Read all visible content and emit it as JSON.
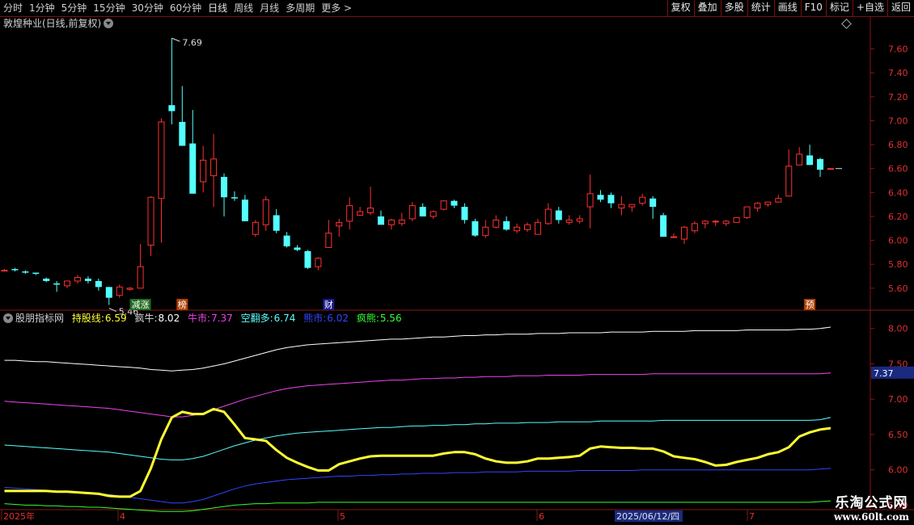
{
  "toolbar": {
    "periods": [
      "分时",
      "1分钟",
      "5分钟",
      "15分钟",
      "30分钟",
      "60分钟",
      "日线",
      "周线",
      "月线",
      "多周期",
      "更多 >"
    ],
    "tools": [
      "复权",
      "叠加",
      "多股",
      "统计",
      "画线",
      "F10",
      "标记",
      "+自选",
      "返回"
    ]
  },
  "stock_title": "敦煌种业(日线,前复权)",
  "indicator": {
    "name": "股朋指标网",
    "items": [
      {
        "label": "持股线:",
        "value": "6.59",
        "color": "#ffff33"
      },
      {
        "label": "疯牛:",
        "value": "8.02",
        "color": "#ffffff"
      },
      {
        "label": "牛市:",
        "value": "7.37",
        "color": "#ee44ee"
      },
      {
        "label": "空翻多:",
        "value": "6.74",
        "color": "#55ffff"
      },
      {
        "label": "熊市:",
        "value": "6.02",
        "color": "#3344ff"
      },
      {
        "label": "疯熊:",
        "value": "5.56",
        "color": "#33ff33"
      }
    ]
  },
  "annotations": {
    "high": "7.69",
    "low": "5.46"
  },
  "markers": [
    {
      "text": "减涨",
      "bg": "#1f6b1f",
      "index": 13
    },
    {
      "text": "榜",
      "bg": "#b04000",
      "index": 17
    },
    {
      "text": "财",
      "bg": "#1a1a8a",
      "index": 31
    },
    {
      "text": "预",
      "bg": "#b04000",
      "index": 77
    }
  ],
  "price_ticks": [
    "7.60",
    "7.40",
    "7.20",
    "7.00",
    "6.80",
    "6.60",
    "6.40",
    "6.20",
    "6.00",
    "5.80",
    "5.60"
  ],
  "ind_ticks": [
    "8.00",
    "7.50",
    "7.00",
    "6.50",
    "6.00",
    "5.50"
  ],
  "ind_tag": "7.37",
  "date_labels": [
    "2025年",
    "4",
    "5",
    "6",
    "2025/06/12/四",
    "7"
  ],
  "watermark": {
    "line1": "乐淘公式网",
    "line2": "www.60lt.com"
  },
  "chart_data": [
    {
      "type": "candlestick",
      "title": "敦煌种业(日线,前复权)",
      "ylim": [
        5.43,
        7.82
      ],
      "colors": {
        "up": "#ff3030",
        "down": "#54ffff"
      },
      "candles": [
        [
          5.75,
          5.76,
          5.75,
          5.75
        ],
        [
          5.76,
          5.77,
          5.74,
          5.75
        ],
        [
          5.74,
          5.75,
          5.72,
          5.73
        ],
        [
          5.73,
          5.73,
          5.71,
          5.72
        ],
        [
          5.68,
          5.69,
          5.65,
          5.66
        ],
        [
          5.64,
          5.66,
          5.57,
          5.63
        ],
        [
          5.62,
          5.66,
          5.6,
          5.66
        ],
        [
          5.66,
          5.71,
          5.64,
          5.69
        ],
        [
          5.68,
          5.7,
          5.64,
          5.66
        ],
        [
          5.66,
          5.68,
          5.58,
          5.61
        ],
        [
          5.61,
          5.61,
          5.46,
          5.52
        ],
        [
          5.54,
          5.63,
          5.52,
          5.61
        ],
        [
          5.59,
          5.61,
          5.58,
          5.6
        ],
        [
          5.6,
          5.97,
          5.6,
          5.78
        ],
        [
          5.96,
          6.37,
          5.87,
          6.36
        ],
        [
          6.35,
          7.02,
          5.98,
          6.99
        ],
        [
          7.13,
          7.69,
          6.97,
          7.08
        ],
        [
          6.99,
          7.29,
          6.83,
          6.79
        ],
        [
          6.81,
          7.09,
          6.73,
          6.39
        ],
        [
          6.49,
          6.79,
          6.4,
          6.67
        ],
        [
          6.54,
          6.89,
          6.28,
          6.68
        ],
        [
          6.53,
          6.56,
          6.2,
          6.36
        ],
        [
          6.36,
          6.41,
          6.33,
          6.35
        ],
        [
          6.34,
          6.38,
          6.16,
          6.16
        ],
        [
          6.05,
          6.17,
          6.03,
          6.15
        ],
        [
          6.13,
          6.37,
          6.08,
          6.34
        ],
        [
          6.21,
          6.26,
          6.06,
          6.08
        ],
        [
          6.04,
          6.07,
          5.94,
          5.95
        ],
        [
          5.94,
          5.96,
          5.91,
          5.92
        ],
        [
          5.91,
          5.92,
          5.76,
          5.77
        ],
        [
          5.78,
          5.86,
          5.75,
          5.85
        ],
        [
          5.94,
          6.17,
          5.94,
          6.06
        ],
        [
          6.12,
          6.18,
          6.03,
          6.15
        ],
        [
          6.16,
          6.36,
          6.09,
          6.29
        ],
        [
          6.21,
          6.28,
          6.21,
          6.24
        ],
        [
          6.23,
          6.45,
          6.21,
          6.27
        ],
        [
          6.2,
          6.25,
          6.14,
          6.13
        ],
        [
          6.13,
          6.18,
          6.09,
          6.17
        ],
        [
          6.14,
          6.23,
          6.12,
          6.17
        ],
        [
          6.18,
          6.32,
          6.16,
          6.29
        ],
        [
          6.28,
          6.31,
          6.21,
          6.2
        ],
        [
          6.2,
          6.25,
          6.18,
          6.24
        ],
        [
          6.26,
          6.33,
          6.25,
          6.33
        ],
        [
          6.33,
          6.34,
          6.27,
          6.29
        ],
        [
          6.28,
          6.31,
          6.14,
          6.17
        ],
        [
          6.16,
          6.18,
          6.03,
          6.04
        ],
        [
          6.04,
          6.17,
          6.02,
          6.11
        ],
        [
          6.11,
          6.21,
          6.1,
          6.17
        ],
        [
          6.16,
          6.2,
          6.08,
          6.09
        ],
        [
          6.08,
          6.14,
          6.06,
          6.11
        ],
        [
          6.09,
          6.15,
          6.07,
          6.13
        ],
        [
          6.05,
          6.18,
          6.05,
          6.15
        ],
        [
          6.14,
          6.31,
          6.13,
          6.26
        ],
        [
          6.25,
          6.28,
          6.14,
          6.17
        ],
        [
          6.15,
          6.21,
          6.13,
          6.17
        ],
        [
          6.16,
          6.21,
          6.14,
          6.18
        ],
        [
          6.28,
          6.55,
          6.1,
          6.39
        ],
        [
          6.38,
          6.42,
          6.32,
          6.34
        ],
        [
          6.38,
          6.4,
          6.27,
          6.31
        ],
        [
          6.27,
          6.37,
          6.21,
          6.3
        ],
        [
          6.28,
          6.3,
          6.24,
          6.3
        ],
        [
          6.31,
          6.39,
          6.29,
          6.36
        ],
        [
          6.35,
          6.37,
          6.18,
          6.28
        ],
        [
          6.21,
          6.23,
          6.03,
          6.03
        ],
        [
          6.03,
          6.06,
          6.02,
          6.03
        ],
        [
          6.01,
          6.12,
          5.97,
          6.11
        ],
        [
          6.08,
          6.16,
          6.06,
          6.14
        ],
        [
          6.14,
          6.17,
          6.1,
          6.16
        ],
        [
          6.16,
          6.17,
          6.12,
          6.16
        ],
        [
          6.14,
          6.17,
          6.12,
          6.16
        ],
        [
          6.15,
          6.19,
          6.15,
          6.19
        ],
        [
          6.19,
          6.28,
          6.18,
          6.28
        ],
        [
          6.27,
          6.32,
          6.24,
          6.31
        ],
        [
          6.3,
          6.32,
          6.28,
          6.32
        ],
        [
          6.32,
          6.38,
          6.32,
          6.35
        ],
        [
          6.37,
          6.76,
          6.37,
          6.62
        ],
        [
          6.63,
          6.78,
          6.63,
          6.72
        ],
        [
          6.71,
          6.8,
          6.63,
          6.63
        ],
        [
          6.68,
          6.69,
          6.53,
          6.59
        ],
        [
          6.6,
          6.6,
          6.6,
          6.6
        ]
      ]
    },
    {
      "type": "line",
      "title": "股朋指标网",
      "ylim": [
        5.47,
        8.1
      ],
      "x_count": 80,
      "series": [
        {
          "name": "疯牛",
          "color": "#ffffff",
          "values": [
            7.55,
            7.55,
            7.54,
            7.53,
            7.53,
            7.52,
            7.51,
            7.5,
            7.49,
            7.48,
            7.47,
            7.46,
            7.45,
            7.44,
            7.42,
            7.41,
            7.4,
            7.41,
            7.42,
            7.44,
            7.47,
            7.5,
            7.54,
            7.58,
            7.62,
            7.66,
            7.7,
            7.73,
            7.75,
            7.77,
            7.78,
            7.79,
            7.8,
            7.81,
            7.82,
            7.83,
            7.84,
            7.85,
            7.85,
            7.86,
            7.87,
            7.88,
            7.88,
            7.89,
            7.9,
            7.9,
            7.91,
            7.91,
            7.92,
            7.92,
            7.92,
            7.93,
            7.93,
            7.93,
            7.94,
            7.94,
            7.94,
            7.94,
            7.95,
            7.95,
            7.95,
            7.95,
            7.96,
            7.96,
            7.96,
            7.96,
            7.97,
            7.97,
            7.97,
            7.97,
            7.97,
            7.98,
            7.98,
            7.98,
            7.98,
            7.98,
            7.99,
            7.99,
            8,
            8.02
          ]
        },
        {
          "name": "牛市",
          "color": "#ee44ee",
          "values": [
            6.97,
            6.96,
            6.95,
            6.94,
            6.93,
            6.92,
            6.91,
            6.9,
            6.89,
            6.88,
            6.87,
            6.85,
            6.83,
            6.81,
            6.79,
            6.77,
            6.75,
            6.75,
            6.77,
            6.8,
            6.85,
            6.9,
            6.95,
            7,
            7.04,
            7.08,
            7.12,
            7.15,
            7.17,
            7.19,
            7.2,
            7.21,
            7.22,
            7.23,
            7.24,
            7.25,
            7.26,
            7.27,
            7.27,
            7.28,
            7.29,
            7.29,
            7.3,
            7.3,
            7.31,
            7.31,
            7.32,
            7.32,
            7.32,
            7.33,
            7.33,
            7.33,
            7.34,
            7.34,
            7.34,
            7.34,
            7.35,
            7.35,
            7.35,
            7.35,
            7.35,
            7.35,
            7.36,
            7.36,
            7.36,
            7.36,
            7.36,
            7.36,
            7.36,
            7.36,
            7.36,
            7.36,
            7.36,
            7.36,
            7.36,
            7.36,
            7.36,
            7.36,
            7.36,
            7.37
          ]
        },
        {
          "name": "空翻多",
          "color": "#55ffff",
          "values": [
            6.35,
            6.34,
            6.33,
            6.32,
            6.31,
            6.3,
            6.29,
            6.28,
            6.27,
            6.26,
            6.25,
            6.23,
            6.21,
            6.19,
            6.17,
            6.15,
            6.14,
            6.14,
            6.16,
            6.19,
            6.24,
            6.29,
            6.34,
            6.38,
            6.42,
            6.45,
            6.48,
            6.5,
            6.52,
            6.53,
            6.54,
            6.55,
            6.56,
            6.57,
            6.58,
            6.59,
            6.6,
            6.6,
            6.61,
            6.62,
            6.62,
            6.63,
            6.63,
            6.64,
            6.64,
            6.65,
            6.65,
            6.66,
            6.66,
            6.66,
            6.67,
            6.67,
            6.67,
            6.68,
            6.68,
            6.68,
            6.68,
            6.69,
            6.69,
            6.69,
            6.69,
            6.69,
            6.69,
            6.7,
            6.7,
            6.7,
            6.7,
            6.7,
            6.7,
            6.7,
            6.7,
            6.7,
            6.7,
            6.7,
            6.7,
            6.7,
            6.7,
            6.7,
            6.71,
            6.74
          ]
        },
        {
          "name": "熊市",
          "color": "#3344ff",
          "values": [
            5.75,
            5.74,
            5.73,
            5.72,
            5.71,
            5.7,
            5.69,
            5.68,
            5.67,
            5.66,
            5.65,
            5.63,
            5.61,
            5.59,
            5.57,
            5.55,
            5.53,
            5.53,
            5.55,
            5.58,
            5.63,
            5.68,
            5.73,
            5.77,
            5.8,
            5.82,
            5.84,
            5.86,
            5.87,
            5.88,
            5.89,
            5.9,
            5.91,
            5.91,
            5.92,
            5.92,
            5.93,
            5.93,
            5.94,
            5.94,
            5.95,
            5.95,
            5.95,
            5.96,
            5.96,
            5.96,
            5.97,
            5.97,
            5.97,
            5.97,
            5.98,
            5.98,
            5.98,
            5.98,
            5.98,
            5.99,
            5.99,
            5.99,
            5.99,
            5.99,
            5.99,
            6,
            6,
            6,
            6,
            6,
            6,
            6,
            6,
            6,
            6,
            6,
            6,
            6,
            6,
            6,
            6,
            6,
            6.01,
            6.02
          ]
        },
        {
          "name": "疯熊",
          "color": "#33ff33",
          "values": [
            5.52,
            5.51,
            5.5,
            5.5,
            5.49,
            5.49,
            5.48,
            5.48,
            5.47,
            5.47,
            5.46,
            5.45,
            5.44,
            5.43,
            5.42,
            5.41,
            5.41,
            5.41,
            5.42,
            5.44,
            5.46,
            5.48,
            5.5,
            5.51,
            5.52,
            5.52,
            5.53,
            5.53,
            5.53,
            5.53,
            5.54,
            5.54,
            5.54,
            5.54,
            5.54,
            5.54,
            5.54,
            5.54,
            5.54,
            5.54,
            5.54,
            5.54,
            5.54,
            5.54,
            5.54,
            5.54,
            5.54,
            5.54,
            5.54,
            5.54,
            5.54,
            5.54,
            5.54,
            5.54,
            5.54,
            5.54,
            5.54,
            5.54,
            5.54,
            5.54,
            5.54,
            5.54,
            5.54,
            5.54,
            5.54,
            5.54,
            5.54,
            5.54,
            5.54,
            5.54,
            5.54,
            5.54,
            5.54,
            5.54,
            5.54,
            5.54,
            5.54,
            5.54,
            5.55,
            5.56
          ]
        },
        {
          "name": "持股线",
          "color": "#ffff33",
          "width": 3,
          "values": [
            5.7,
            5.7,
            5.7,
            5.7,
            5.7,
            5.69,
            5.69,
            5.68,
            5.67,
            5.66,
            5.63,
            5.62,
            5.62,
            5.7,
            6.02,
            6.43,
            6.74,
            6.82,
            6.79,
            6.79,
            6.86,
            6.82,
            6.64,
            6.45,
            6.43,
            6.41,
            6.28,
            6.17,
            6.1,
            6.04,
            5.99,
            5.99,
            6.08,
            6.12,
            6.16,
            6.19,
            6.2,
            6.2,
            6.2,
            6.2,
            6.2,
            6.2,
            6.23,
            6.25,
            6.25,
            6.22,
            6.16,
            6.12,
            6.1,
            6.1,
            6.12,
            6.16,
            6.16,
            6.17,
            6.18,
            6.2,
            6.3,
            6.33,
            6.32,
            6.31,
            6.31,
            6.3,
            6.3,
            6.26,
            6.19,
            6.17,
            6.15,
            6.11,
            6.06,
            6.07,
            6.11,
            6.14,
            6.17,
            6.22,
            6.25,
            6.32,
            6.47,
            6.53,
            6.57,
            6.59
          ]
        }
      ]
    }
  ]
}
